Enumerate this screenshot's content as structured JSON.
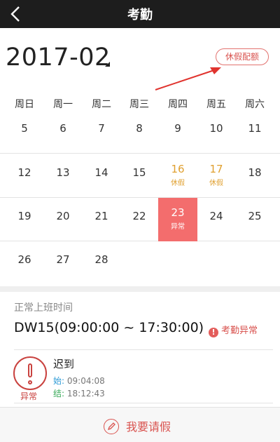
{
  "header": {
    "title": "考勤"
  },
  "calendar": {
    "month": "2017-02",
    "quota_label": "休假配额",
    "weekdays": [
      "周日",
      "周一",
      "周二",
      "周三",
      "周四",
      "周五",
      "周六"
    ],
    "rows": [
      [
        {
          "d": "5"
        },
        {
          "d": "6"
        },
        {
          "d": "7"
        },
        {
          "d": "8"
        },
        {
          "d": "9"
        },
        {
          "d": "10"
        },
        {
          "d": "11"
        }
      ],
      [
        {
          "d": "12"
        },
        {
          "d": "13"
        },
        {
          "d": "14"
        },
        {
          "d": "15"
        },
        {
          "d": "16",
          "sub": "休假"
        },
        {
          "d": "17",
          "sub": "休假"
        },
        {
          "d": "18"
        }
      ],
      [
        {
          "d": "19"
        },
        {
          "d": "20"
        },
        {
          "d": "21"
        },
        {
          "d": "22"
        },
        {
          "d": "23",
          "sub": "异常"
        },
        {
          "d": "24"
        },
        {
          "d": "25"
        }
      ],
      [
        {
          "d": "26"
        },
        {
          "d": "27"
        },
        {
          "d": "28"
        }
      ]
    ]
  },
  "detail": {
    "section_label": "正常上班时间",
    "shift": "DW15(09:00:00 ~ 17:30:00)",
    "abnormal_tag": "考勤异常",
    "stamp_label": "异常",
    "record_title": "迟到",
    "start_key": "始:",
    "start_time": "09:04:08",
    "end_key": "结:",
    "end_time": "18:12:43"
  },
  "footer": {
    "leave_button": "我要请假"
  },
  "colors": {
    "accent": "#d9534f",
    "abnormal_cell": "#f36d6d",
    "leave_text": "#e0a030",
    "topbar": "#1d1d1d"
  }
}
